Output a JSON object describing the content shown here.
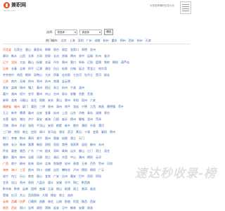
{
  "header": {
    "logo_text": "兼职网",
    "logo_sub": "jianzhi.com",
    "right_text": "为您推荐兼职信息大全"
  },
  "search": {
    "label": "选择:",
    "province_value": "请选择",
    "city_value": "请选择",
    "submit_label": "确定"
  },
  "hot_cities": {
    "label": "热门城市:",
    "cities": [
      "北京",
      "上海",
      "深圳",
      "广州",
      "成都",
      "杭州",
      "重庆",
      "郑州",
      "西安",
      "苏州",
      "天津"
    ]
  },
  "rows": [
    {
      "cities": [
        "河北省",
        "石家庄",
        "唐山",
        "秦皇岛",
        "邯郸",
        "邢台",
        "保定",
        "张家口",
        "承德",
        "沧州"
      ],
      "highlight": [
        0
      ]
    },
    {
      "cities": [
        "廊坊",
        "衡水",
        "山西",
        "太原",
        "大同",
        "阳泉",
        "长治",
        "晋城",
        "朔州",
        "晋中",
        "运城",
        "忻州",
        "临汾"
      ],
      "highlight": []
    },
    {
      "cities": [
        "辽宁",
        "沈阳",
        "大连",
        "鞍山",
        "抚顺",
        "本溪",
        "丹东",
        "锦州",
        "营口",
        "阜新",
        "辽阳",
        "盘锦",
        "铁岭",
        "朝阳",
        "葫芦岛"
      ],
      "highlight": [
        0,
        1
      ]
    },
    {
      "cities": [
        "吉林",
        "长春",
        "吉林",
        "四平",
        "辽源",
        "通化",
        "白山",
        "松原",
        "白城",
        "延边",
        "黑龙江",
        "哈尔滨"
      ],
      "highlight": [
        0
      ]
    },
    {
      "cities": [
        "齐齐哈尔",
        "鸡西",
        "鹤岗",
        "双鸭山",
        "大庆",
        "伊春",
        "佳木斯",
        "七台河",
        "牡丹江",
        "黑河",
        "绥化"
      ],
      "highlight": []
    },
    {
      "cities": [
        "江苏",
        "南京",
        "无锡",
        "徐州",
        "常州",
        "苏州",
        "南通",
        "连云港"
      ],
      "highlight": [
        0
      ]
    },
    {
      "cities": [
        "淮安",
        "盐城",
        "扬州",
        "镇江",
        "泰州",
        "宿迁",
        "浙江",
        "杭州",
        "宁波",
        "温州"
      ],
      "highlight": []
    },
    {
      "cities": [
        "嘉兴",
        "湖州",
        "绍兴",
        "金华",
        "衢州",
        "舟山",
        "台州",
        "丽水",
        "安徽",
        "合肥",
        "芜湖"
      ],
      "highlight": []
    },
    {
      "cities": [
        "蚌埠",
        "淮南",
        "马鞍山",
        "淮北",
        "铜陵",
        "安庆",
        "黄山",
        "滁州",
        "阜阳",
        "宿州",
        "六安"
      ],
      "highlight": []
    },
    {
      "cities": [
        "福建省",
        "福州",
        "厦门",
        "莆田",
        "三明",
        "泉州",
        "漳州",
        "南平",
        "龙岩",
        "宁德",
        "江西",
        "南昌",
        "景德镇",
        "萍乡"
      ],
      "highlight": [
        0,
        1
      ]
    },
    {
      "cities": [
        "九江",
        "新余",
        "鹰潭",
        "赣州",
        "吉安",
        "宜春",
        "抚州",
        "上饶",
        "山东",
        "济南",
        "青岛",
        "淄博",
        "枣庄"
      ],
      "highlight": []
    },
    {
      "cities": [
        "东营",
        "烟台",
        "潍坊",
        "济宁",
        "泰安",
        "威海",
        "日照",
        "临沂",
        "德州",
        "聊城",
        "滨州",
        "菏泽"
      ],
      "highlight": []
    },
    {
      "cities": [
        "河南",
        "郑州",
        "开封",
        "洛阳",
        "平顶山",
        "安阳",
        "鹤壁",
        "新乡",
        "焦作",
        "濮阳",
        "许昌",
        "漯河"
      ],
      "highlight": []
    },
    {
      "cities": [
        "三门峡",
        "南阳",
        "商丘",
        "信阳",
        "周口",
        "驻马店",
        "湖北",
        "武汉",
        "黄石",
        "十堰",
        "宜昌",
        "襄阳",
        "鄂州"
      ],
      "highlight": []
    },
    {
      "cities": [
        "荆门",
        "孝感",
        "荆州",
        "黄冈",
        "咸宁",
        "随州",
        "恩施",
        "仙桃",
        "潜江",
        "天门"
      ],
      "highlight": []
    },
    {
      "cities": [
        "湖南",
        "长沙",
        "株洲",
        "湘潭",
        "衡阳",
        "邵阳",
        "岳阳",
        "常德",
        "张家界",
        "益阳",
        "郴州",
        "永州"
      ],
      "highlight": []
    },
    {
      "cities": [
        "怀化",
        "娄底",
        "湘西",
        "广东",
        "广州",
        "韶关",
        "深圳",
        "珠海",
        "汕头",
        "佛山",
        "江门",
        "湛江",
        "茂名"
      ],
      "highlight": []
    },
    {
      "cities": [
        "肇庆",
        "惠州",
        "梅州",
        "汕尾",
        "河源",
        "阳江",
        "清远",
        "东莞",
        "中山",
        "潮州",
        "揭阳",
        "云浮"
      ],
      "highlight": []
    },
    {
      "cities": [
        "广西",
        "南宁",
        "柳州",
        "桂林",
        "梧州",
        "北海",
        "防城港",
        "钦州",
        "贵港",
        "玉林",
        "百色",
        "贺州",
        "河池"
      ],
      "highlight": [
        0
      ]
    },
    {
      "cities": [
        "海南",
        "海口",
        "三亚",
        "儋州",
        "四川",
        "成都",
        "自贡",
        "攀枝花",
        "泸州",
        "德阳",
        "绵阳",
        "广元"
      ],
      "highlight": [
        0,
        1,
        2
      ]
    },
    {
      "cities": [
        "遂宁",
        "内江",
        "乐山",
        "南充",
        "眉山",
        "宜宾",
        "广安",
        "达州",
        "雅安",
        "巴中",
        "资阳",
        "阿坝"
      ],
      "highlight": []
    },
    {
      "cities": [
        "甘孜",
        "凉山",
        "贵州",
        "贵阳",
        "六盘水",
        "遵义",
        "安顺",
        "毕节",
        "铜仁",
        "黔西南"
      ],
      "highlight": []
    },
    {
      "cities": [
        "黔东南",
        "黔南",
        "云南",
        "昆明",
        "曲靖",
        "玉溪",
        "保山",
        "昭通",
        "丽江",
        "普洱",
        "临沧"
      ],
      "highlight": []
    },
    {
      "cities": [
        "楚雄",
        "红河",
        "文山",
        "西双版纳",
        "大理",
        "德宏",
        "怒江",
        "迪庆"
      ],
      "highlight": []
    },
    {
      "cities": [
        "云南",
        "西藏",
        "拉萨",
        "日喀则",
        "昌都",
        "林芝",
        "山南",
        "那曲",
        "阿里",
        "陕西",
        "西安"
      ],
      "highlight": [
        0,
        1,
        2
      ]
    },
    {
      "cities": [
        "陕西",
        "西安",
        "铜川",
        "宝鸡",
        "咸阳",
        "渭南",
        "延安",
        "汉中",
        "榆林",
        "安康",
        "商洛"
      ],
      "highlight": [
        0,
        1
      ]
    }
  ],
  "watermark_text": "速达秒收录-榜"
}
